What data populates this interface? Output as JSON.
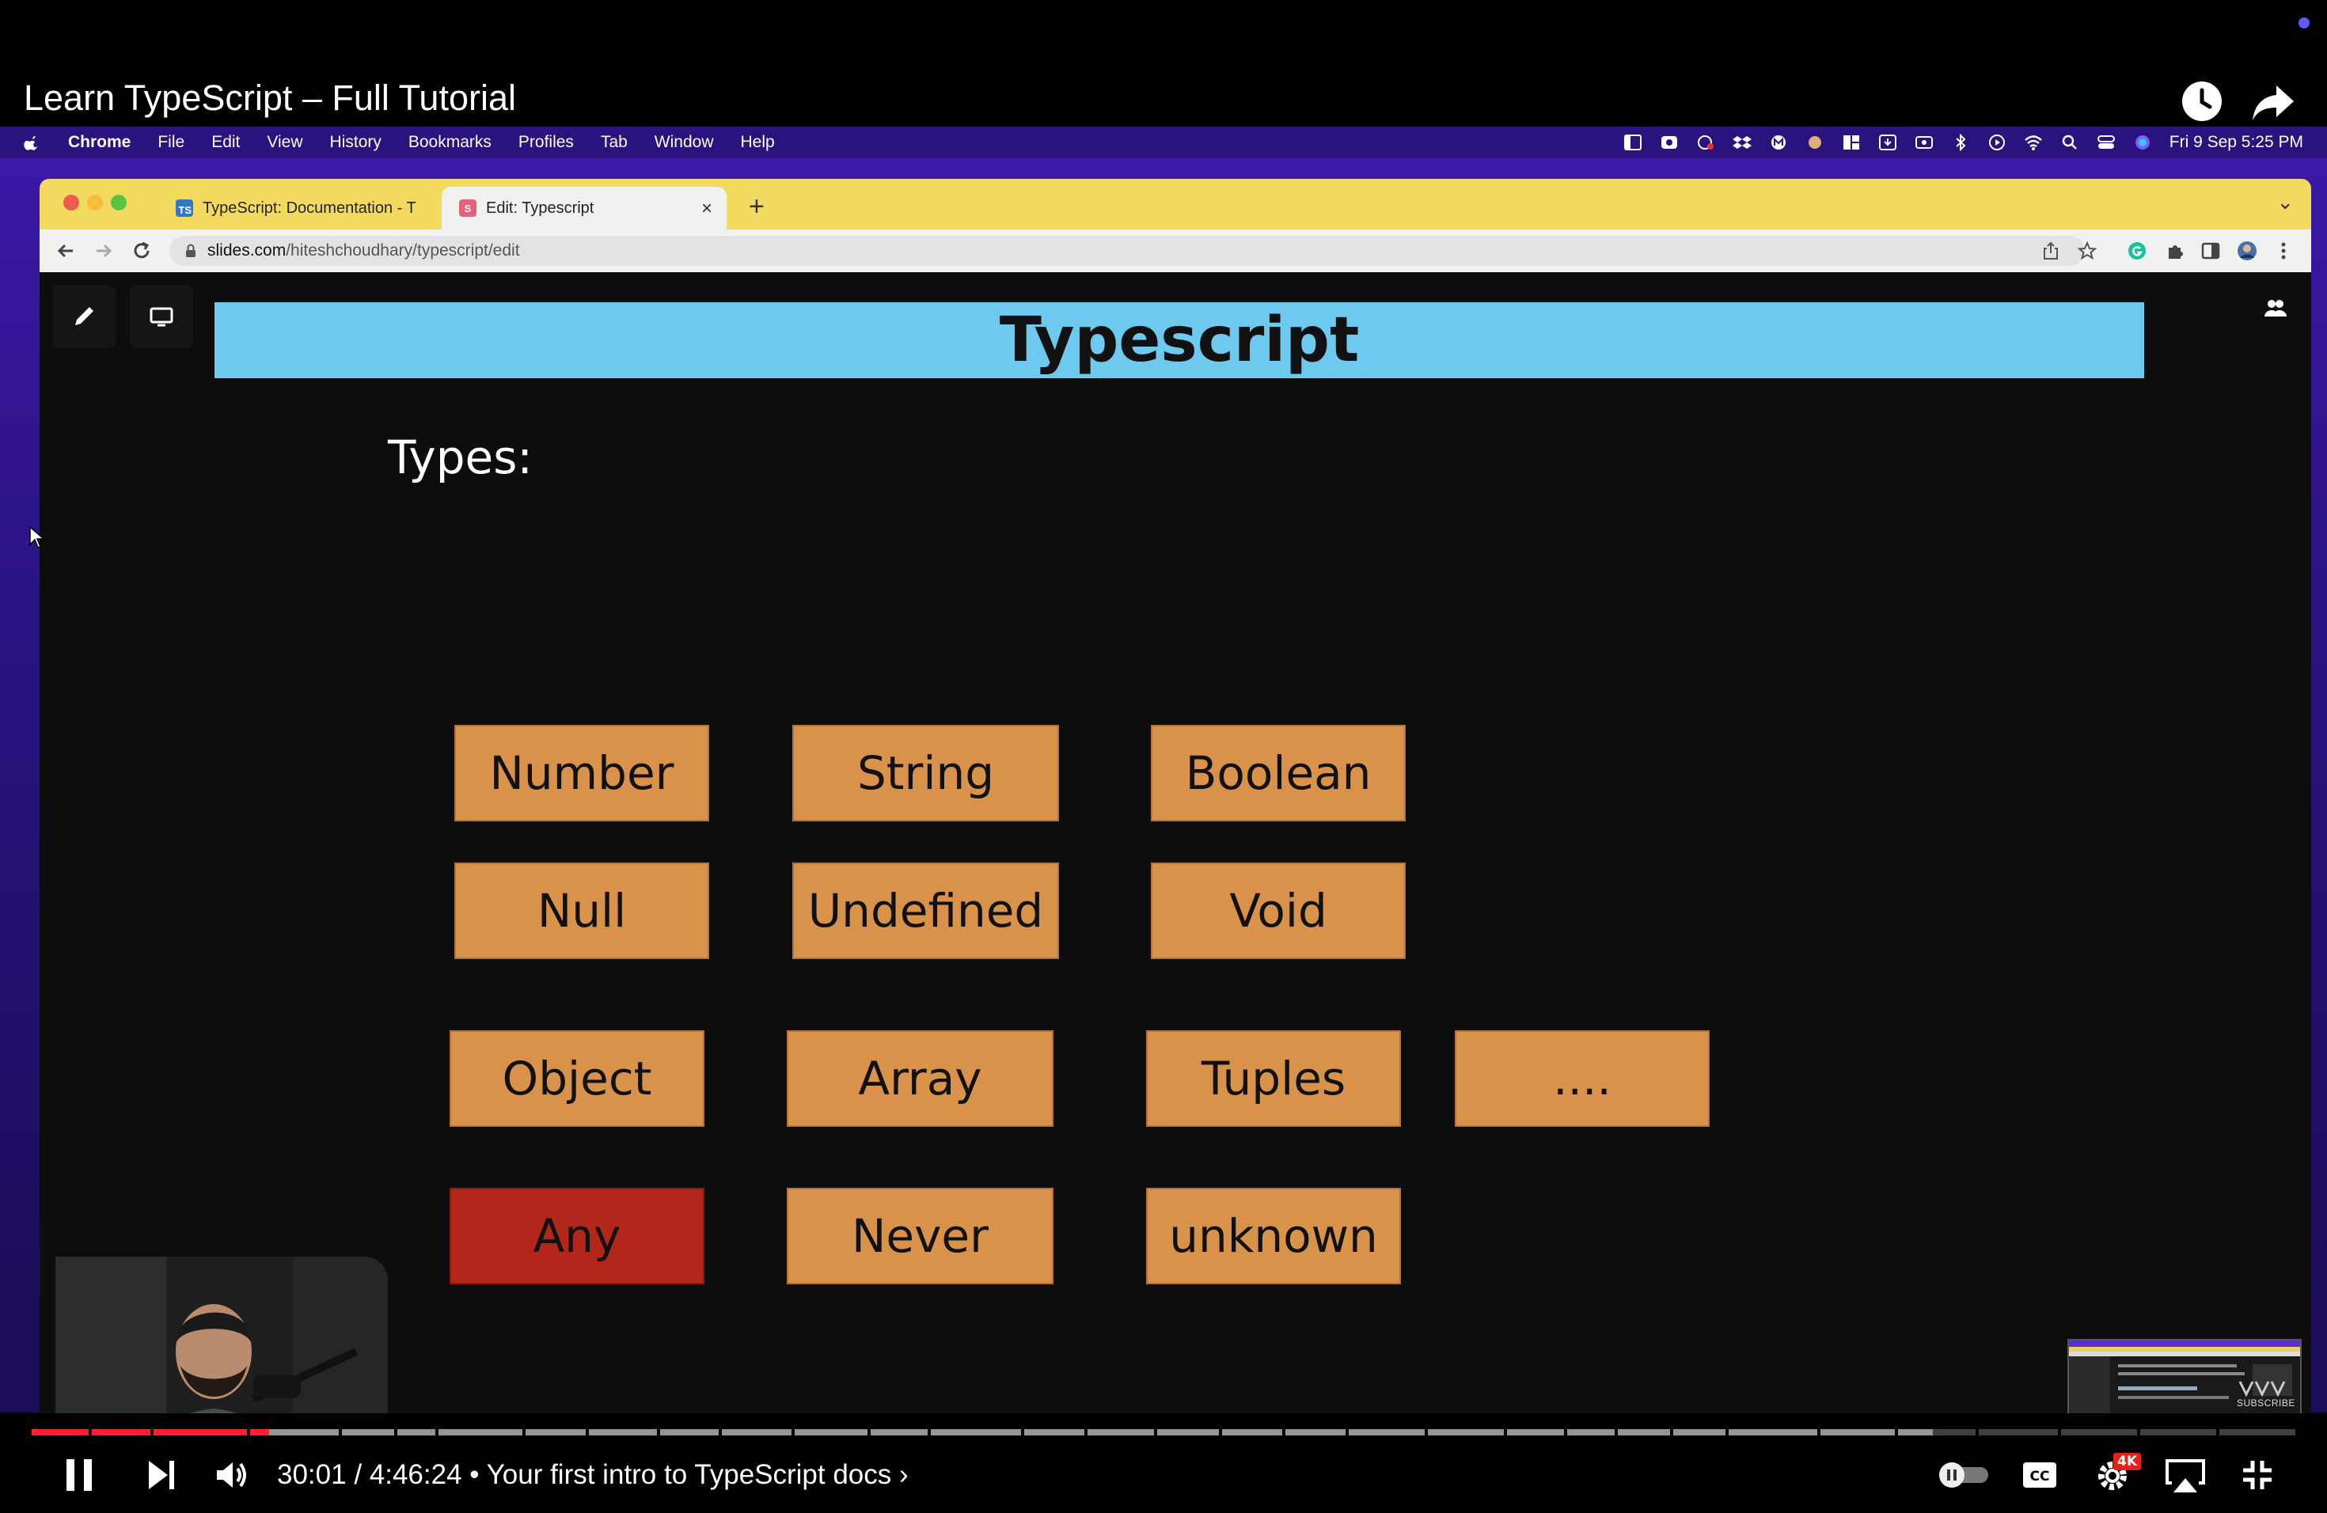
{
  "video": {
    "title": "Learn TypeScript – Full Tutorial",
    "time_current": "30:01",
    "time_total": "4:46:24",
    "chapter": "Your first intro to TypeScript docs",
    "quality_badge": "4K",
    "subscribe_label": "SUBSCRIBE",
    "progress_fraction": 0.105,
    "buffered_fraction": 0.84
  },
  "macos_menu": {
    "app": "Chrome",
    "items": [
      "File",
      "Edit",
      "View",
      "History",
      "Bookmarks",
      "Profiles",
      "Tab",
      "Window",
      "Help"
    ],
    "clock": "Fri 9 Sep  5:25 PM"
  },
  "browser": {
    "tabs": [
      {
        "title": "TypeScript: Documentation - T",
        "favicon": "TS",
        "favicon_color": "#3178c6"
      },
      {
        "title": "Edit: Typescript",
        "favicon": "S",
        "favicon_color": "#e4637c"
      }
    ],
    "url_host": "slides.com",
    "url_path": "/hiteshchoudhary/typescript/edit"
  },
  "slide": {
    "title": "Typescript",
    "types_label": "Types:",
    "types": [
      "Number",
      "String",
      "Boolean",
      "Null",
      "Undefined",
      "Void",
      "Object",
      "Array",
      "Tuples",
      "....",
      "Any",
      "Never",
      "unknown"
    ],
    "box_color": "#d9924a",
    "highlight_color": "#b3271a"
  }
}
